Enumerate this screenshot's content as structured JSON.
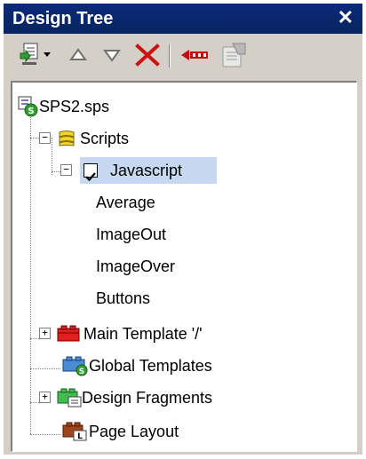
{
  "panel": {
    "title": "Design Tree",
    "close_label": "✕"
  },
  "toolbar": {
    "buttons": [
      {
        "name": "add-script-icon"
      },
      {
        "name": "dropdown-arrow-icon"
      },
      {
        "name": "move-up-icon"
      },
      {
        "name": "move-down-icon"
      },
      {
        "name": "delete-icon"
      },
      {
        "name": "collapse-icon"
      },
      {
        "name": "properties-icon"
      }
    ]
  },
  "tree": {
    "root": {
      "label": "SPS2.sps"
    },
    "scripts": {
      "label": "Scripts",
      "expander": "−"
    },
    "javascript": {
      "label": "Javascript",
      "expander": "−",
      "checked": true
    },
    "functions": [
      {
        "label": "Average"
      },
      {
        "label": "ImageOut"
      },
      {
        "label": "ImageOver"
      },
      {
        "label": "Buttons"
      }
    ],
    "main_template": {
      "label": "Main Template '/'",
      "expander": "+"
    },
    "global_templates": {
      "label": "Global Templates"
    },
    "design_fragments": {
      "label": "Design Fragments",
      "expander": "+"
    },
    "page_layout": {
      "label": "Page Layout"
    }
  }
}
